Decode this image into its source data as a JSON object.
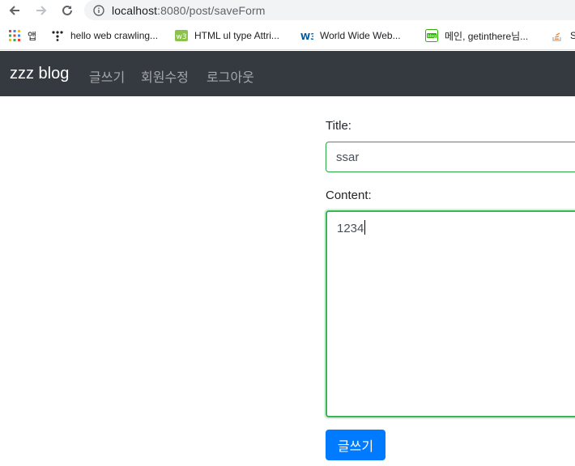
{
  "browser": {
    "url_host": "localhost",
    "url_rest": ":8080/post/saveForm",
    "bookmarks": [
      {
        "label": "앱",
        "icon": "apps-grid-icon"
      },
      {
        "label": "hello web crawling...",
        "icon": "dots-logo-icon"
      },
      {
        "label": "HTML ul type Attri...",
        "icon": "w3-green-icon"
      },
      {
        "label": "World Wide Web...",
        "icon": "w3c-icon"
      },
      {
        "label": "메인, getinthere님...",
        "icon": "blog-icon"
      },
      {
        "label": "S",
        "icon": "stackoverflow-icon"
      }
    ]
  },
  "navbar": {
    "brand": "zzz blog",
    "links": [
      "글쓰기",
      "회원수정",
      "로그아웃"
    ]
  },
  "form": {
    "title_label": "Title:",
    "title_value": "ssar",
    "content_label": "Content:",
    "content_value": "1234",
    "submit_label": "글쓰기"
  },
  "colors": {
    "navbar_bg": "#343a40",
    "valid_border": "#28a745",
    "primary_button": "#007bff"
  }
}
